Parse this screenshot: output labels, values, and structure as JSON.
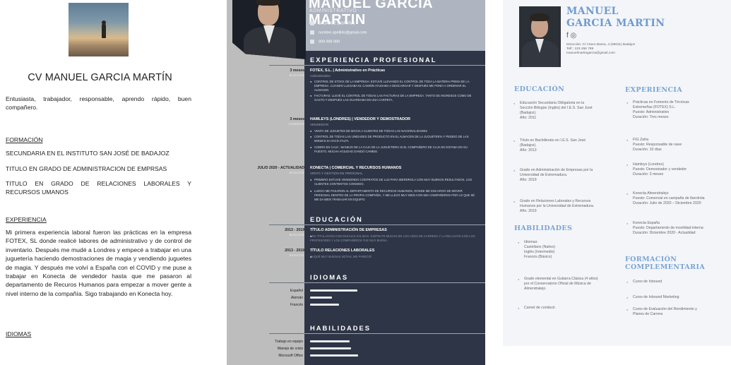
{
  "cv1": {
    "title": "CV MANUEL GARCIA MARTÍN",
    "intro": "Entusiasta, trabajador, responsable, aprendo rápido, buen compañero.",
    "formacion_heading": "FORMACIÓN",
    "formacion": [
      "SECUNDARIA EN EL INSTITUTO SAN JOSÉ DE BADAJOZ",
      "TITULO EN GRADO DE ADMINISTRACION DE EMPRSAS",
      "TITULO EN GRADO DE RELACIONES LABORALES Y RECURSOS UMANOS"
    ],
    "experiencia_heading": "EXPERIENCIA",
    "experiencia_text": "Mi primera experiencia laboral fueron las prácticas en la empresa FOTEX, SL donde realicé labores de administrativo y de control de inventario. Después me mudé a Londres y empecé a trabajar en una juguetería haciendo demostraciones de magia y vendiendo juguetes de magia. Y después me volví a España con el COVID y me puse a trabajar en Konecta de vendedor hasta que me pasaron al departamento de Recuros Humanos para empezar a mover gente a nivel interno de la compañía. Sigo trabajando en Konecta hoy.",
    "idiomas_heading": "IDIOMAS"
  },
  "cv2": {
    "name": "MANUEL GARCIA MARTIN",
    "role": "ADMINISTRATIVO",
    "contact": [
      "BADAJOZ (ESPAÑA)",
      "nombre.apellido@gmail.com",
      "999 999 999"
    ],
    "sections": {
      "experiencia": "EXPERIENCIA PROFESIONAL",
      "educacion": "EDUCACIÓN",
      "idiomas": "IDIOMAS",
      "habilidades": "HABILIDADES"
    },
    "jobs": [
      {
        "date": "3 meses",
        "place": "BADAJOZ",
        "title": "FOTEX, S.L. | Administrativo en Prácticas",
        "subtitle": "Administrativo",
        "bullets": [
          "CONTROL DE STOCK DE LA EMPRESA: ESTUVE LLEVANDO EL CONTROL DE TODA LA MATERIA PRIMA DE LA EMPRESA. CUANDO LLEGABA EL CAMIÓN AYUDABA A DESCARGAR Y DESPUÉS ME PONÍA A ORDENAR EL ALMACEN",
          "FACTURAS: LLEVÉ EL CONTROL DE TODAS LAS FACTURAS DE LA EMPRESA. TANTO DE INGRESOS COMO DE GASTO Y DESPUÉS LAS GUARDABA EN UNA CARPETA."
        ]
      },
      {
        "date": "3 meses",
        "place": "LONDRES",
        "title": "HAMLEYS (LONDRES) | VENDEDOR Y DEMOSTRADOR",
        "subtitle": "VENDEDOR",
        "bullets": [
          "VENTA DE JUGUETES DE MAGIA A CLIENTES DE TODAS LAS NACIONALIDADES",
          "CONTROL DE TODAS LAS UNIDADES DE PRODUCTO EN EL ALMACEN DE LA JUGUETERIA Y PEDIDO DE LAS MISMAS SI HACÍA FALTA",
          "COBRO EN CAJA : MANEJO DE LA CAJA DE LA JUGUETERIA SI EL COMPAÑERO DE CAJA NO ESTABA EN SU PUESTO. MUCHA AGILIDAD DANDO CAMBIO."
        ]
      },
      {
        "date": "JULIO 2020 - ACTUALIDAD",
        "place": "BADAJOZ",
        "title": "KONECTA | COMERCIAL Y RECURSOS HUMANOS",
        "subtitle": "VENTA Y GESTION DE PERSONAL",
        "bullets": [
          "PRIMERO ESTUVE VENDIENDO CONTRATOS DE LUZ PARA IBERDROLA CON MUY BUENOS RESULTADOS. LOS CLIENTES CONTENTOS CONMIGO.",
          "LUEGO ME PASARON AL DEPARTAMENTO DE RECURSOS HUMANOS, DONDE ME ENCARGO DE MOVER PERSONAL DENTRO DE LA PROPIA COMPAÑÍA, Y ME LLEVO MUY BIEN CON MIS COMPAÑEROS POR LO QUE SÉ ME DA BIEN TRABAJAR EN EQUIPO."
        ]
      }
    ],
    "education": [
      {
        "date": "2013 - 2019",
        "place": "BADAJOZ",
        "title": "TÍTULO ADMINISTRACIÓN DE EMPRESAS",
        "desc": "UNA TITULACIÓN CON MUCHAS SALIDAS. DISFRUTÉ MUCHO EN LOS AÑOS DE CARRERA Y LA RELACIÓN CON LOS PROFESORES Y LOS COMPAÑEROS FUE MUY BUENA."
      },
      {
        "date": "2013 - 2019",
        "place": "BADAJOZ",
        "title": "TÍTULO RELACIONES LABORALES",
        "desc": "SAQUÉ MUY BUENAS NOTAS. ME PARECIÓ"
      }
    ],
    "languages": [
      {
        "name": "Español",
        "level": 0.9
      },
      {
        "name": "Alemán",
        "level": 0.42
      },
      {
        "name": "Francés",
        "level": 0.55
      }
    ],
    "skills": [
      {
        "name": "Trabajo en equipo",
        "level": 0.75
      },
      {
        "name": "Manejo de crisis",
        "level": 0.78
      },
      {
        "name": "Microsoft Office",
        "level": 0.92
      }
    ]
  },
  "cv3": {
    "name_line1": "MANUEL",
    "name_line2": "GARCIA MARTIN",
    "social": "f ◎",
    "contact": [
      "Dirección: C/ Arturo Barea, 4 (06011) Badajoz",
      "Telf.: 123 456 789",
      "manuelmartingarcia@gmail.com"
    ],
    "educacion_heading": "EDUCACIÓN",
    "educacion": [
      [
        "Educación Secundaria Obligatoria en la",
        "Sección Bilingüe (Inglés) del I.E.S. San José",
        "(Badajoz).",
        "Año: 2011"
      ],
      [
        "Título en Bachillerato en I.E.S. San José",
        "(Badajoz).",
        "Año: 2013"
      ],
      [
        "Grado en Administración de Empresas por la",
        "Universidad de Extremadura.",
        "Año: 2019"
      ],
      [
        "Grado en Relaciones Laborales y Recursos",
        "Humanos por la Universidad de Extremadura.",
        "Año: 2019"
      ]
    ],
    "habilidades_heading": "HABILIDADES",
    "habilidades": [
      [
        "Idiomas:",
        "Castellano (Nativo)",
        "Inglés (Intermedio)",
        "Francés (Básico)"
      ],
      [
        "Grado elemental en Guitarra Clásica (4 años)",
        "por el Conservatorio Oficial de Música de",
        "Almendralejo."
      ],
      [
        "Carnet de conducir."
      ]
    ],
    "experiencia_heading": "EXPERIENCIA",
    "experiencia": [
      [
        "Prácticas en Fomento de Técnicas",
        "Extremeñas (FOTEX) S.L.",
        "Puesto: Administrativo",
        "Duración: Tres meses"
      ],
      [
        "FIG Zafra",
        "Puesto: Responsable de nave",
        "Duración: 10 días"
      ],
      [
        "Hamleys (Londres)",
        "Puesto: Demostrador y vendedor",
        "Duración: 3 meses"
      ],
      [
        "Konecta Almendralejo",
        "Puesto: Comercial en campaña de Iberdrola",
        "Duración: Julio de 2020 – Diciembre 2020"
      ],
      [
        "Konecta España",
        "Puesto: Departamento de movilidad interna",
        "Duración: Diciembre 2020 - Actualidad"
      ]
    ],
    "formacion_heading_1": "FORMACIÓN",
    "formacion_heading_2": "COMPLEMENTARIA",
    "formacion": [
      [
        "Curso de Inbound"
      ],
      [
        "Curso de Inbound Marketing"
      ],
      [
        "Curso de Evaluación del Rendimiento y",
        "Planes de Carrera"
      ]
    ]
  }
}
